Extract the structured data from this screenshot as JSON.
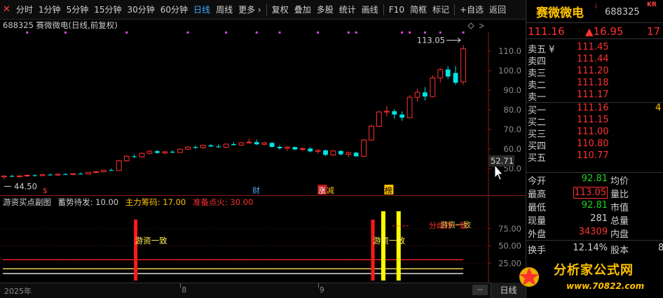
{
  "toolbar": {
    "items": [
      {
        "label": "分时",
        "active": false
      },
      {
        "label": "1分钟",
        "active": false
      },
      {
        "label": "5分钟",
        "active": false
      },
      {
        "label": "15分钟",
        "active": false
      },
      {
        "label": "30分钟",
        "active": false
      },
      {
        "label": "60分钟",
        "active": false
      },
      {
        "label": "日线",
        "active": true
      },
      {
        "label": "周线",
        "active": false
      },
      {
        "label": "更多 ›",
        "active": false
      },
      {
        "label": "复权",
        "active": false
      },
      {
        "label": "叠加",
        "active": false
      },
      {
        "label": "多股",
        "active": false
      },
      {
        "label": "统计",
        "active": false
      },
      {
        "label": "画线",
        "active": false
      },
      {
        "label": "F10",
        "active": false
      },
      {
        "label": "简框",
        "active": false
      },
      {
        "label": "标记",
        "active": false
      },
      {
        "label": "+自选",
        "active": false
      },
      {
        "label": "返回",
        "active": false
      }
    ]
  },
  "chart_title": "688325 赛微微电(日线,前复权)",
  "chart_data": [
    {
      "type": "candlestick",
      "title": "688325 赛微微电(日线,前复权)",
      "y_ticks": [
        50.0,
        60.0,
        70.0,
        80.0,
        90.0,
        100.0,
        110.0
      ],
      "ylim": [
        40,
        120
      ],
      "current_price_label": "52.71",
      "max_label": "113.05",
      "min_label": "44.50",
      "markers": [
        "$",
        "财",
        "涨",
        "减",
        "榜"
      ],
      "candles": [
        {
          "o": 45.8,
          "h": 46.5,
          "l": 44.5,
          "c": 46.2
        },
        {
          "o": 46.2,
          "h": 46.8,
          "l": 45.6,
          "c": 45.9
        },
        {
          "o": 45.9,
          "h": 46.6,
          "l": 45.2,
          "c": 46.3
        },
        {
          "o": 46.3,
          "h": 47.0,
          "l": 45.8,
          "c": 46.6
        },
        {
          "o": 46.6,
          "h": 47.1,
          "l": 46.0,
          "c": 46.4
        },
        {
          "o": 46.4,
          "h": 47.2,
          "l": 46.1,
          "c": 46.9
        },
        {
          "o": 46.9,
          "h": 47.5,
          "l": 46.5,
          "c": 46.7
        },
        {
          "o": 46.7,
          "h": 47.3,
          "l": 46.3,
          "c": 47.1
        },
        {
          "o": 47.1,
          "h": 47.8,
          "l": 46.8,
          "c": 47.0
        },
        {
          "o": 47.0,
          "h": 47.6,
          "l": 46.6,
          "c": 47.4
        },
        {
          "o": 47.4,
          "h": 48.0,
          "l": 47.0,
          "c": 47.2
        },
        {
          "o": 47.2,
          "h": 48.3,
          "l": 47.0,
          "c": 48.1
        },
        {
          "o": 48.1,
          "h": 48.8,
          "l": 47.6,
          "c": 48.4
        },
        {
          "o": 48.4,
          "h": 49.5,
          "l": 48.0,
          "c": 49.2
        },
        {
          "o": 49.2,
          "h": 50.0,
          "l": 48.8,
          "c": 49.0
        },
        {
          "o": 49.0,
          "h": 54.5,
          "l": 48.8,
          "c": 54.0
        },
        {
          "o": 54.0,
          "h": 56.8,
          "l": 53.5,
          "c": 56.3
        },
        {
          "o": 56.3,
          "h": 57.2,
          "l": 55.4,
          "c": 56.0
        },
        {
          "o": 56.0,
          "h": 58.2,
          "l": 55.6,
          "c": 57.8
        },
        {
          "o": 57.8,
          "h": 59.3,
          "l": 57.2,
          "c": 58.9
        },
        {
          "o": 58.9,
          "h": 59.6,
          "l": 57.6,
          "c": 58.0
        },
        {
          "o": 58.0,
          "h": 59.0,
          "l": 57.2,
          "c": 58.6
        },
        {
          "o": 58.6,
          "h": 59.4,
          "l": 57.8,
          "c": 58.2
        },
        {
          "o": 58.2,
          "h": 60.2,
          "l": 58.0,
          "c": 59.9
        },
        {
          "o": 59.9,
          "h": 61.5,
          "l": 59.5,
          "c": 61.0
        },
        {
          "o": 61.0,
          "h": 61.8,
          "l": 60.0,
          "c": 60.6
        },
        {
          "o": 60.6,
          "h": 62.3,
          "l": 60.2,
          "c": 61.9
        },
        {
          "o": 61.9,
          "h": 62.5,
          "l": 61.0,
          "c": 61.3
        },
        {
          "o": 61.3,
          "h": 62.4,
          "l": 60.5,
          "c": 60.9
        },
        {
          "o": 60.9,
          "h": 62.8,
          "l": 60.6,
          "c": 62.5
        },
        {
          "o": 62.5,
          "h": 63.5,
          "l": 61.8,
          "c": 62.0
        },
        {
          "o": 62.0,
          "h": 63.6,
          "l": 61.7,
          "c": 63.2
        },
        {
          "o": 63.2,
          "h": 65.2,
          "l": 62.8,
          "c": 63.5
        },
        {
          "o": 63.5,
          "h": 64.8,
          "l": 62.0,
          "c": 62.4
        },
        {
          "o": 62.4,
          "h": 63.7,
          "l": 61.9,
          "c": 63.1
        },
        {
          "o": 63.1,
          "h": 63.6,
          "l": 60.7,
          "c": 61.1
        },
        {
          "o": 61.1,
          "h": 61.9,
          "l": 59.6,
          "c": 60.4
        },
        {
          "o": 60.4,
          "h": 61.4,
          "l": 59.1,
          "c": 61.0
        },
        {
          "o": 61.0,
          "h": 61.3,
          "l": 59.4,
          "c": 59.8
        },
        {
          "o": 59.8,
          "h": 60.7,
          "l": 58.8,
          "c": 60.2
        },
        {
          "o": 60.2,
          "h": 60.9,
          "l": 58.3,
          "c": 58.8
        },
        {
          "o": 58.8,
          "h": 59.8,
          "l": 57.6,
          "c": 59.3
        },
        {
          "o": 59.3,
          "h": 59.7,
          "l": 56.6,
          "c": 57.0
        },
        {
          "o": 57.0,
          "h": 59.5,
          "l": 56.4,
          "c": 59.0
        },
        {
          "o": 59.0,
          "h": 59.4,
          "l": 56.7,
          "c": 57.3
        },
        {
          "o": 57.3,
          "h": 58.8,
          "l": 55.8,
          "c": 58.1
        },
        {
          "o": 58.1,
          "h": 58.6,
          "l": 55.9,
          "c": 56.3
        },
        {
          "o": 56.3,
          "h": 65.0,
          "l": 56.0,
          "c": 64.6
        },
        {
          "o": 64.6,
          "h": 72.5,
          "l": 64.2,
          "c": 71.6
        },
        {
          "o": 71.6,
          "h": 79.5,
          "l": 71.2,
          "c": 78.9
        },
        {
          "o": 78.9,
          "h": 82.0,
          "l": 76.6,
          "c": 79.3
        },
        {
          "o": 79.3,
          "h": 80.3,
          "l": 75.5,
          "c": 77.6
        },
        {
          "o": 77.6,
          "h": 79.2,
          "l": 74.4,
          "c": 76.0
        },
        {
          "o": 76.0,
          "h": 87.5,
          "l": 75.7,
          "c": 86.4
        },
        {
          "o": 86.4,
          "h": 90.8,
          "l": 84.2,
          "c": 88.9
        },
        {
          "o": 88.9,
          "h": 91.6,
          "l": 84.8,
          "c": 86.8
        },
        {
          "o": 86.8,
          "h": 97.7,
          "l": 86.4,
          "c": 96.3
        },
        {
          "o": 96.3,
          "h": 101.2,
          "l": 93.9,
          "c": 100.6
        },
        {
          "o": 100.6,
          "h": 102.3,
          "l": 95.7,
          "c": 97.0
        },
        {
          "o": 98.8,
          "h": 102.4,
          "l": 92.8,
          "c": 93.8
        },
        {
          "o": 94.3,
          "h": 113.05,
          "l": 92.81,
          "c": 111.16
        }
      ],
      "top_dots": [
        3,
        8,
        16,
        24,
        29,
        33,
        36,
        41,
        45,
        46,
        52,
        53,
        55,
        57,
        60
      ]
    },
    {
      "type": "bar",
      "title": "游资买点副图",
      "legend": [
        {
          "name": "蓄势待发: 10.00",
          "color": "#d0d0d0"
        },
        {
          "name": "主力筹码: 17.00",
          "color": "#ffc100"
        },
        {
          "name": "准备点火: 30.00",
          "color": "#ff3030"
        }
      ],
      "y_ticks": [
        25.0,
        50.0,
        75.0
      ],
      "ylim": [
        0,
        100
      ],
      "lines": [
        {
          "name": "准备点火",
          "value": 30,
          "color": "#ff2020"
        },
        {
          "name": "主力筹码",
          "value": 17,
          "color": "#ffe066"
        },
        {
          "name": "蓄势待发",
          "value": 10,
          "color": "#f0f0f0"
        }
      ],
      "bars": [
        {
          "index": 17,
          "value": 88,
          "color": "#ff1a1a",
          "label": "游资一致"
        },
        {
          "index": 48,
          "value": 88,
          "color": "#ff1a1a",
          "label": "游资一致"
        },
        {
          "index": 49,
          "value": 100,
          "color": "#ffff00",
          "label": ""
        },
        {
          "index": 51,
          "value": 100,
          "color": "#ffff00",
          "label": ""
        }
      ],
      "overlay_label": "分歧转一致",
      "overlay_label2": "游资一致"
    }
  ],
  "time_axis": {
    "labels": [
      {
        "text": "2025年",
        "index": 0
      },
      {
        "text": "8",
        "index": 21
      },
      {
        "text": "9",
        "index": 39
      }
    ],
    "period_label": "日线",
    "scroll_label": "--"
  },
  "quote": {
    "name": "赛微微电",
    "info_icon": "i",
    "code": "688325",
    "badge": "KR",
    "price": "111.16",
    "change": "▲16.95",
    "change_pct": "17",
    "order_book": [
      {
        "label": "卖五 ¥",
        "price": "111.45",
        "vol": ""
      },
      {
        "label": "卖四",
        "price": "111.44",
        "vol": ""
      },
      {
        "label": "卖三",
        "price": "111.20",
        "vol": ""
      },
      {
        "label": "卖二",
        "price": "111.18",
        "vol": ""
      },
      {
        "label": "卖一",
        "price": "111.17",
        "vol": ""
      },
      {
        "label": "买一",
        "price": "111.16",
        "vol": "4"
      },
      {
        "label": "买二",
        "price": "111.15",
        "vol": ""
      },
      {
        "label": "买三",
        "price": "111.00",
        "vol": ""
      },
      {
        "label": "买四",
        "price": "110.80",
        "vol": ""
      },
      {
        "label": "买五",
        "price": "110.77",
        "vol": ""
      }
    ],
    "stats": [
      {
        "l1": "今开",
        "v1": "92.81",
        "c1": "green",
        "l2": "均价",
        "v2": ""
      },
      {
        "l1": "最高",
        "v1": "113.05",
        "c1": "red boxed",
        "l2": "量比",
        "v2": ""
      },
      {
        "l1": "最低",
        "v1": "92.81",
        "c1": "green",
        "l2": "市值",
        "v2": ""
      },
      {
        "l1": "现量",
        "v1": "281",
        "c1": "white",
        "l2": "总量",
        "v2": ""
      },
      {
        "l1": "外盘",
        "v1": "34309",
        "c1": "red",
        "l2": "内盘",
        "v2": ""
      },
      {
        "l1": "换手",
        "v1": "12.14%",
        "c1": "white",
        "l2": "股本",
        "v2": "8"
      },
      {
        "l1": "",
        "v1": "",
        "c1": "white",
        "l2": "",
        "v2": ""
      }
    ]
  },
  "watermark": {
    "title": "分析家公式网",
    "url": "www.70822.com"
  },
  "colors": {
    "up": "#ff3030",
    "down": "#00e5e5",
    "grid": "#7a1f1f",
    "axis_text": "#8c8c8c",
    "accent": "#3fa9ff",
    "dot": "#e040e0"
  }
}
